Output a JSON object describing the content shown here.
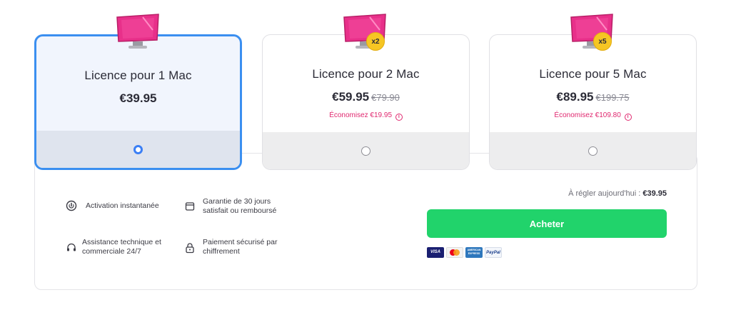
{
  "plans": [
    {
      "title": "Licence pour 1 Mac",
      "price": "€39.95",
      "old_price": "",
      "savings": "",
      "badge": "",
      "selected": true
    },
    {
      "title": "Licence pour 2 Mac",
      "price": "€59.95",
      "old_price": "€79.90",
      "savings": "Économisez €19.95",
      "badge": "x2",
      "selected": false
    },
    {
      "title": "Licence pour 5 Mac",
      "price": "€89.95",
      "old_price": "€199.75",
      "savings": "Économisez €109.80",
      "badge": "x5",
      "selected": false
    }
  ],
  "features": [
    {
      "label": "Activation instantanée",
      "icon": "power-icon"
    },
    {
      "label": "Garantie de 30 jours satisfait ou remboursé",
      "icon": "wallet-icon"
    },
    {
      "label": "Assistance technique et commerciale 24/7",
      "icon": "headset-icon"
    },
    {
      "label": "Paiement sécurisé par chiffrement",
      "icon": "lock-icon"
    }
  ],
  "checkout": {
    "due_label": "À régler aujourd'hui :",
    "due_amount": "€39.95",
    "buy_label": "Acheter"
  },
  "payment_methods": [
    "VISA",
    "mastercard",
    "AMERICAN EXPRESS",
    "PayPal"
  ],
  "colors": {
    "accent": "#3b8ff0",
    "buy": "#21d36b",
    "savings": "#e0286f",
    "badge": "#f6c623",
    "mac": "#e8308a"
  }
}
